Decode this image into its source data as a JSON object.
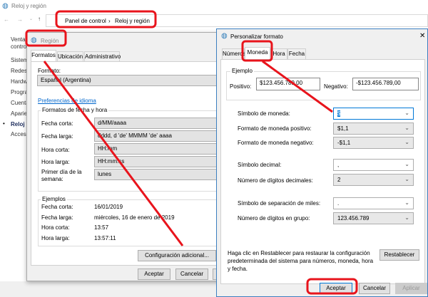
{
  "window": {
    "title": "Reloj y región",
    "breadcrumb": [
      "Panel de control",
      "Reloj y región"
    ],
    "sidebar": [
      "Ventana",
      "control",
      "Sistema",
      "Redes",
      "Hardw",
      "Progra",
      "Cuenta",
      "Aparie",
      "Reloj y",
      "Accesi"
    ]
  },
  "region": {
    "title": "Región",
    "tabs": [
      "Formatos",
      "Ubicación",
      "Administrativo"
    ],
    "format_label": "Formato:",
    "format_value": "Español (Argentina)",
    "lang_link": "Preferencias de idioma",
    "group": "Formatos de fecha y hora",
    "rows": [
      {
        "label": "Fecha corta:",
        "value": "d/MM/aaaa"
      },
      {
        "label": "Fecha larga:",
        "value": "dddd, d 'de' MMMM 'de' aaaa"
      },
      {
        "label": "Hora corta:",
        "value": "HH:mm"
      },
      {
        "label": "Hora larga:",
        "value": "HH:mm:ss"
      },
      {
        "label": "Primer día de la semana:",
        "value": "lunes"
      }
    ],
    "examples_title": "Ejemplos",
    "examples": [
      {
        "label": "Fecha corta:",
        "value": "16/01/2019"
      },
      {
        "label": "Fecha larga:",
        "value": "miércoles, 16 de enero de 2019"
      },
      {
        "label": "Hora corta:",
        "value": "13:57"
      },
      {
        "label": "Hora larga:",
        "value": "13:57:11"
      }
    ],
    "additional": "Configuración adicional...",
    "ok": "Aceptar",
    "cancel": "Cancelar"
  },
  "custom": {
    "title": "Personalizar formato",
    "close": "✕",
    "tabs": [
      "Números",
      "Moneda",
      "Hora",
      "Fecha"
    ],
    "example_title": "Ejemplo",
    "pos_label": "Positivo:",
    "pos_value": "$123.456.789,00",
    "neg_label": "Negativo:",
    "neg_value": "-$123.456.789,00",
    "rows": [
      {
        "label": "Símbolo de moneda:",
        "value": "$"
      },
      {
        "label": "Formato de moneda positivo:",
        "value": "$1,1"
      },
      {
        "label": "Formato de moneda negativo:",
        "value": "-$1,1"
      },
      {
        "label": "Símbolo decimal:",
        "value": ","
      },
      {
        "label": "Número de dígitos decimales:",
        "value": "2"
      },
      {
        "label": "Símbolo de separación de miles:",
        "value": "."
      },
      {
        "label": "Número de dígitos en grupo:",
        "value": "123.456.789"
      }
    ],
    "note": "Haga clic en Restablecer para restaurar la configuración predeterminada del sistema para números, moneda, hora y fecha.",
    "reset": "Restablecer",
    "ok": "Aceptar",
    "cancel": "Cancelar",
    "apply": "Aplicar"
  },
  "colors": {
    "annotation": "#e8141c",
    "link": "#0066cc",
    "accent": "#0078d7"
  }
}
